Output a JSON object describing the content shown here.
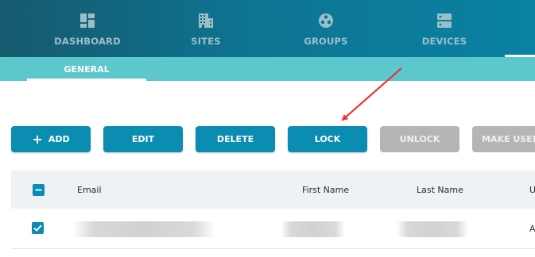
{
  "nav": {
    "items": [
      {
        "label": "DASHBOARD",
        "icon": "dashboard-icon"
      },
      {
        "label": "SITES",
        "icon": "building-icon"
      },
      {
        "label": "GROUPS",
        "icon": "groups-icon"
      },
      {
        "label": "DEVICES",
        "icon": "devices-icon"
      }
    ]
  },
  "subnav": {
    "tabs": [
      {
        "label": "GENERAL"
      }
    ]
  },
  "toolbar": {
    "add_label": "ADD",
    "edit_label": "EDIT",
    "delete_label": "DELETE",
    "lock_label": "LOCK",
    "unlock_label": "UNLOCK",
    "make_user_label": "MAKE USER L"
  },
  "table": {
    "columns": [
      "Email",
      "First Name",
      "Last Name",
      "U"
    ],
    "rows": [
      {
        "selected": true,
        "email": "",
        "first_name": "",
        "last_name": "",
        "col4": "A"
      }
    ]
  },
  "colors": {
    "nav_bg": "#0e7391",
    "subnav_bg": "#5cc7cd",
    "accent": "#0b8cb1",
    "disabled": "#b5b5b5",
    "annotation_arrow": "#e53935"
  }
}
